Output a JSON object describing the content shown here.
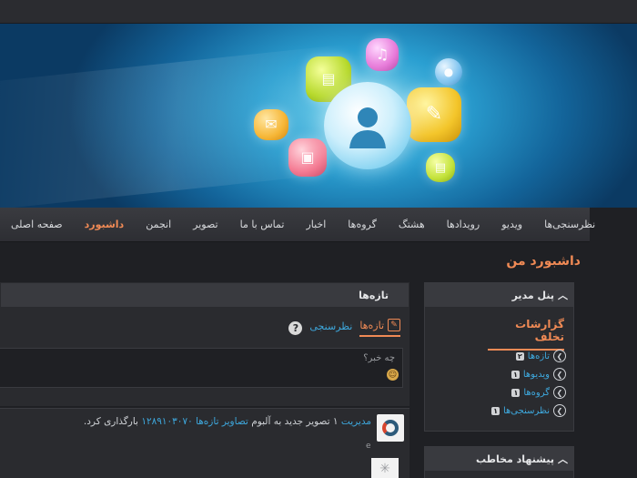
{
  "nav": {
    "items": [
      {
        "label": "صفحه اصلی"
      },
      {
        "label": "داشبورد",
        "active": true
      },
      {
        "label": "انجمن"
      },
      {
        "label": "تصویر"
      },
      {
        "label": "تماس با ما"
      },
      {
        "label": "اخبار"
      },
      {
        "label": "گروه‌ها"
      },
      {
        "label": "هشتگ"
      },
      {
        "label": "رویدادها"
      },
      {
        "label": "ویدیو"
      },
      {
        "label": "نظرسنجی‌ها"
      }
    ]
  },
  "page": {
    "title": "داشبورد من"
  },
  "feed": {
    "header": "تازه‌ها",
    "tabs": {
      "news": "تازه‌ها",
      "poll": "نظرسنجی"
    },
    "status_placeholder": "چه خبر؟",
    "activity": {
      "user": "مدیریت",
      "text_1": "۱ تصویر جدید به آلبوم",
      "album": "تصاویر تازه‌ها ۱۲۸۹۱۰۳۰۷۰",
      "text_2": "بارگذاری کرد.",
      "small": "e"
    }
  },
  "admin_panel": {
    "header": "پنل مدیر",
    "reports_title": "گزارشات تخلف",
    "reports": [
      {
        "label": "تازه‌ها",
        "count": "۲"
      },
      {
        "label": "ویدیوها",
        "count": "۱"
      },
      {
        "label": "گروه‌ها",
        "count": "۱"
      },
      {
        "label": "نظرسنجی‌ها",
        "count": "۱"
      }
    ]
  },
  "suggest_panel": {
    "header": "پیشنهاد مخاطب"
  },
  "colors": {
    "accent": "#f08a55",
    "link": "#3ea8dd",
    "background": "#1f2024"
  }
}
